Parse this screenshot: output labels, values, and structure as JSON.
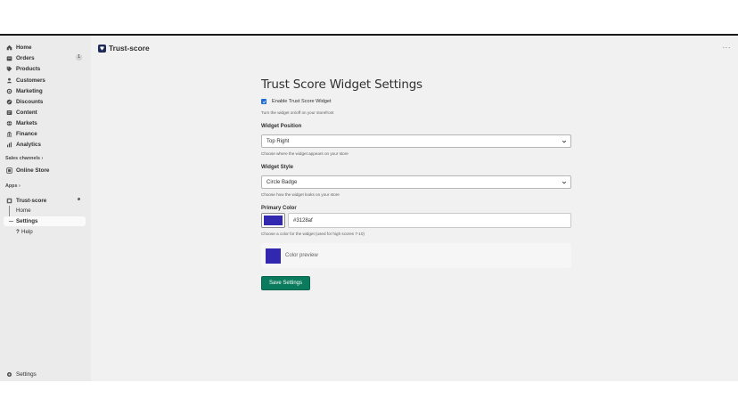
{
  "sidebar": {
    "items": [
      {
        "label": "Home",
        "icon": "home-icon"
      },
      {
        "label": "Orders",
        "icon": "orders-icon",
        "badge": "1"
      },
      {
        "label": "Products",
        "icon": "tag-icon"
      },
      {
        "label": "Customers",
        "icon": "person-icon"
      },
      {
        "label": "Marketing",
        "icon": "target-icon"
      },
      {
        "label": "Discounts",
        "icon": "discount-icon"
      },
      {
        "label": "Content",
        "icon": "content-icon"
      },
      {
        "label": "Markets",
        "icon": "globe-icon"
      },
      {
        "label": "Finance",
        "icon": "bank-icon"
      },
      {
        "label": "Analytics",
        "icon": "chart-icon"
      }
    ],
    "sales_channels_label": "Sales channels",
    "online_store_label": "Online Store",
    "apps_label": "Apps",
    "app_name": "Trust-score",
    "app_sub_items": [
      {
        "label": "Home"
      },
      {
        "label": "Settings"
      },
      {
        "label": "Help"
      }
    ],
    "settings_label": "Settings"
  },
  "topbar": {
    "title": "Trust-score",
    "more": "···"
  },
  "main": {
    "heading": "Trust Score Widget Settings",
    "enable_label": "Enable Trust Score Widget",
    "enable_checked": true,
    "enable_help": "Turn the widget on/off on your storefront",
    "position_label": "Widget Position",
    "position_value": "Top Right",
    "position_help": "Choose where the widget appears on your store",
    "style_label": "Widget Style",
    "style_value": "Circle Badge",
    "style_help": "Choose how the widget looks on your store",
    "color_label": "Primary Color",
    "color_value": "#3128af",
    "color_help": "Choose a color for the widget (used for high scores 7-10)",
    "preview_label": "Color preview",
    "save_label": "Save Settings"
  },
  "colors": {
    "primary": "#3128af",
    "save_button": "#0a7b5c"
  }
}
